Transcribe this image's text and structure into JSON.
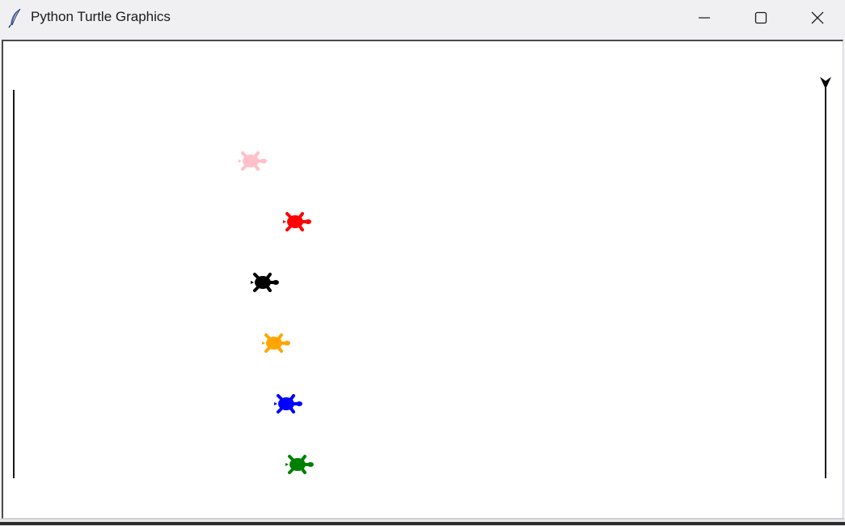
{
  "window": {
    "title": "Python Turtle Graphics",
    "app_icon": "feather-icon"
  },
  "controls": {
    "minimize_icon": "minimize-icon",
    "maximize_icon": "maximize-icon",
    "close_icon": "close-icon"
  },
  "canvas": {
    "background": "#ffffff",
    "start_line_color": "#1a1a1a",
    "finish_line_color": "#1a1a1a",
    "finish_marker_icon": "arrow-turtle-down-icon",
    "turtles": [
      {
        "color": "#ffc0cb",
        "name": "pink"
      },
      {
        "color": "#ff0000",
        "name": "red"
      },
      {
        "color": "#000000",
        "name": "black"
      },
      {
        "color": "#ffa500",
        "name": "orange"
      },
      {
        "color": "#0000ff",
        "name": "blue"
      },
      {
        "color": "#008000",
        "name": "green"
      }
    ]
  }
}
